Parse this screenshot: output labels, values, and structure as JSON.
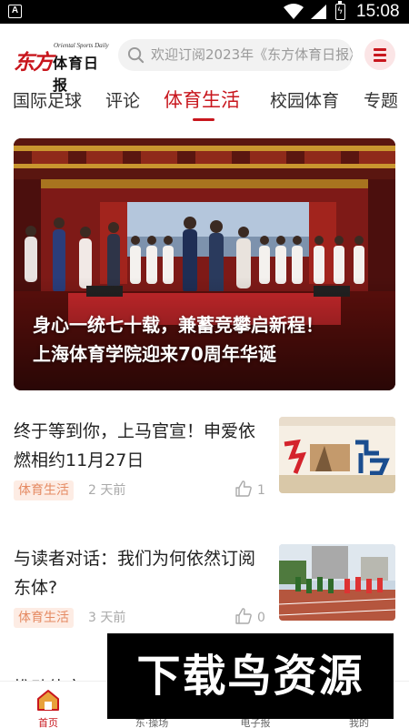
{
  "status_bar": {
    "notification_icon": "A",
    "icons": [
      "notification-icon",
      "wifi-icon",
      "signal-icon",
      "battery-icon"
    ],
    "time": "15:08"
  },
  "header": {
    "logo_cn_red": "东方",
    "logo_cn": "体育日报",
    "logo_en": "Oriental Sports Daily",
    "search_placeholder": "欢迎订阅2023年《东方体育日报》",
    "menu_icon": "hamburger-menu-icon"
  },
  "tabs": [
    {
      "label": "国际足球",
      "active": false
    },
    {
      "label": "评论",
      "active": false
    },
    {
      "label": "体育生活",
      "active": true
    },
    {
      "label": "校园体育",
      "active": false
    },
    {
      "label": "专题",
      "active": false
    }
  ],
  "hero": {
    "title_line1": "身心一统七十载，兼蓄竞攀启新程！",
    "title_line2": "上海体育学院迎来70周年华诞"
  },
  "news": [
    {
      "title": "终于等到你，上马官宣！申爱依燃相约11月27日",
      "tag": "体育生活",
      "time": "2 天前",
      "likes": "1",
      "thumb": "shanghai-marathon-poster"
    },
    {
      "title": "与读者对话：我们为何依然订阅东体?",
      "tag": "体育生活",
      "time": "3 天前",
      "likes": "0",
      "thumb": "runners-on-track-photo"
    }
  ],
  "partial_news_title": "推动体育",
  "bottom_nav": [
    {
      "label": "首页",
      "icon": "home-icon",
      "active": true
    },
    {
      "label": "东·操场",
      "icon": "playground-icon",
      "active": false
    },
    {
      "label": "电子报",
      "icon": "newspaper-icon",
      "active": false
    },
    {
      "label": "我的",
      "icon": "profile-icon",
      "active": false
    }
  ],
  "watermark": "下载鸟资源",
  "colors": {
    "accent": "#c8161d",
    "tag_bg": "#fdece4",
    "tag_text": "#e58a62"
  }
}
